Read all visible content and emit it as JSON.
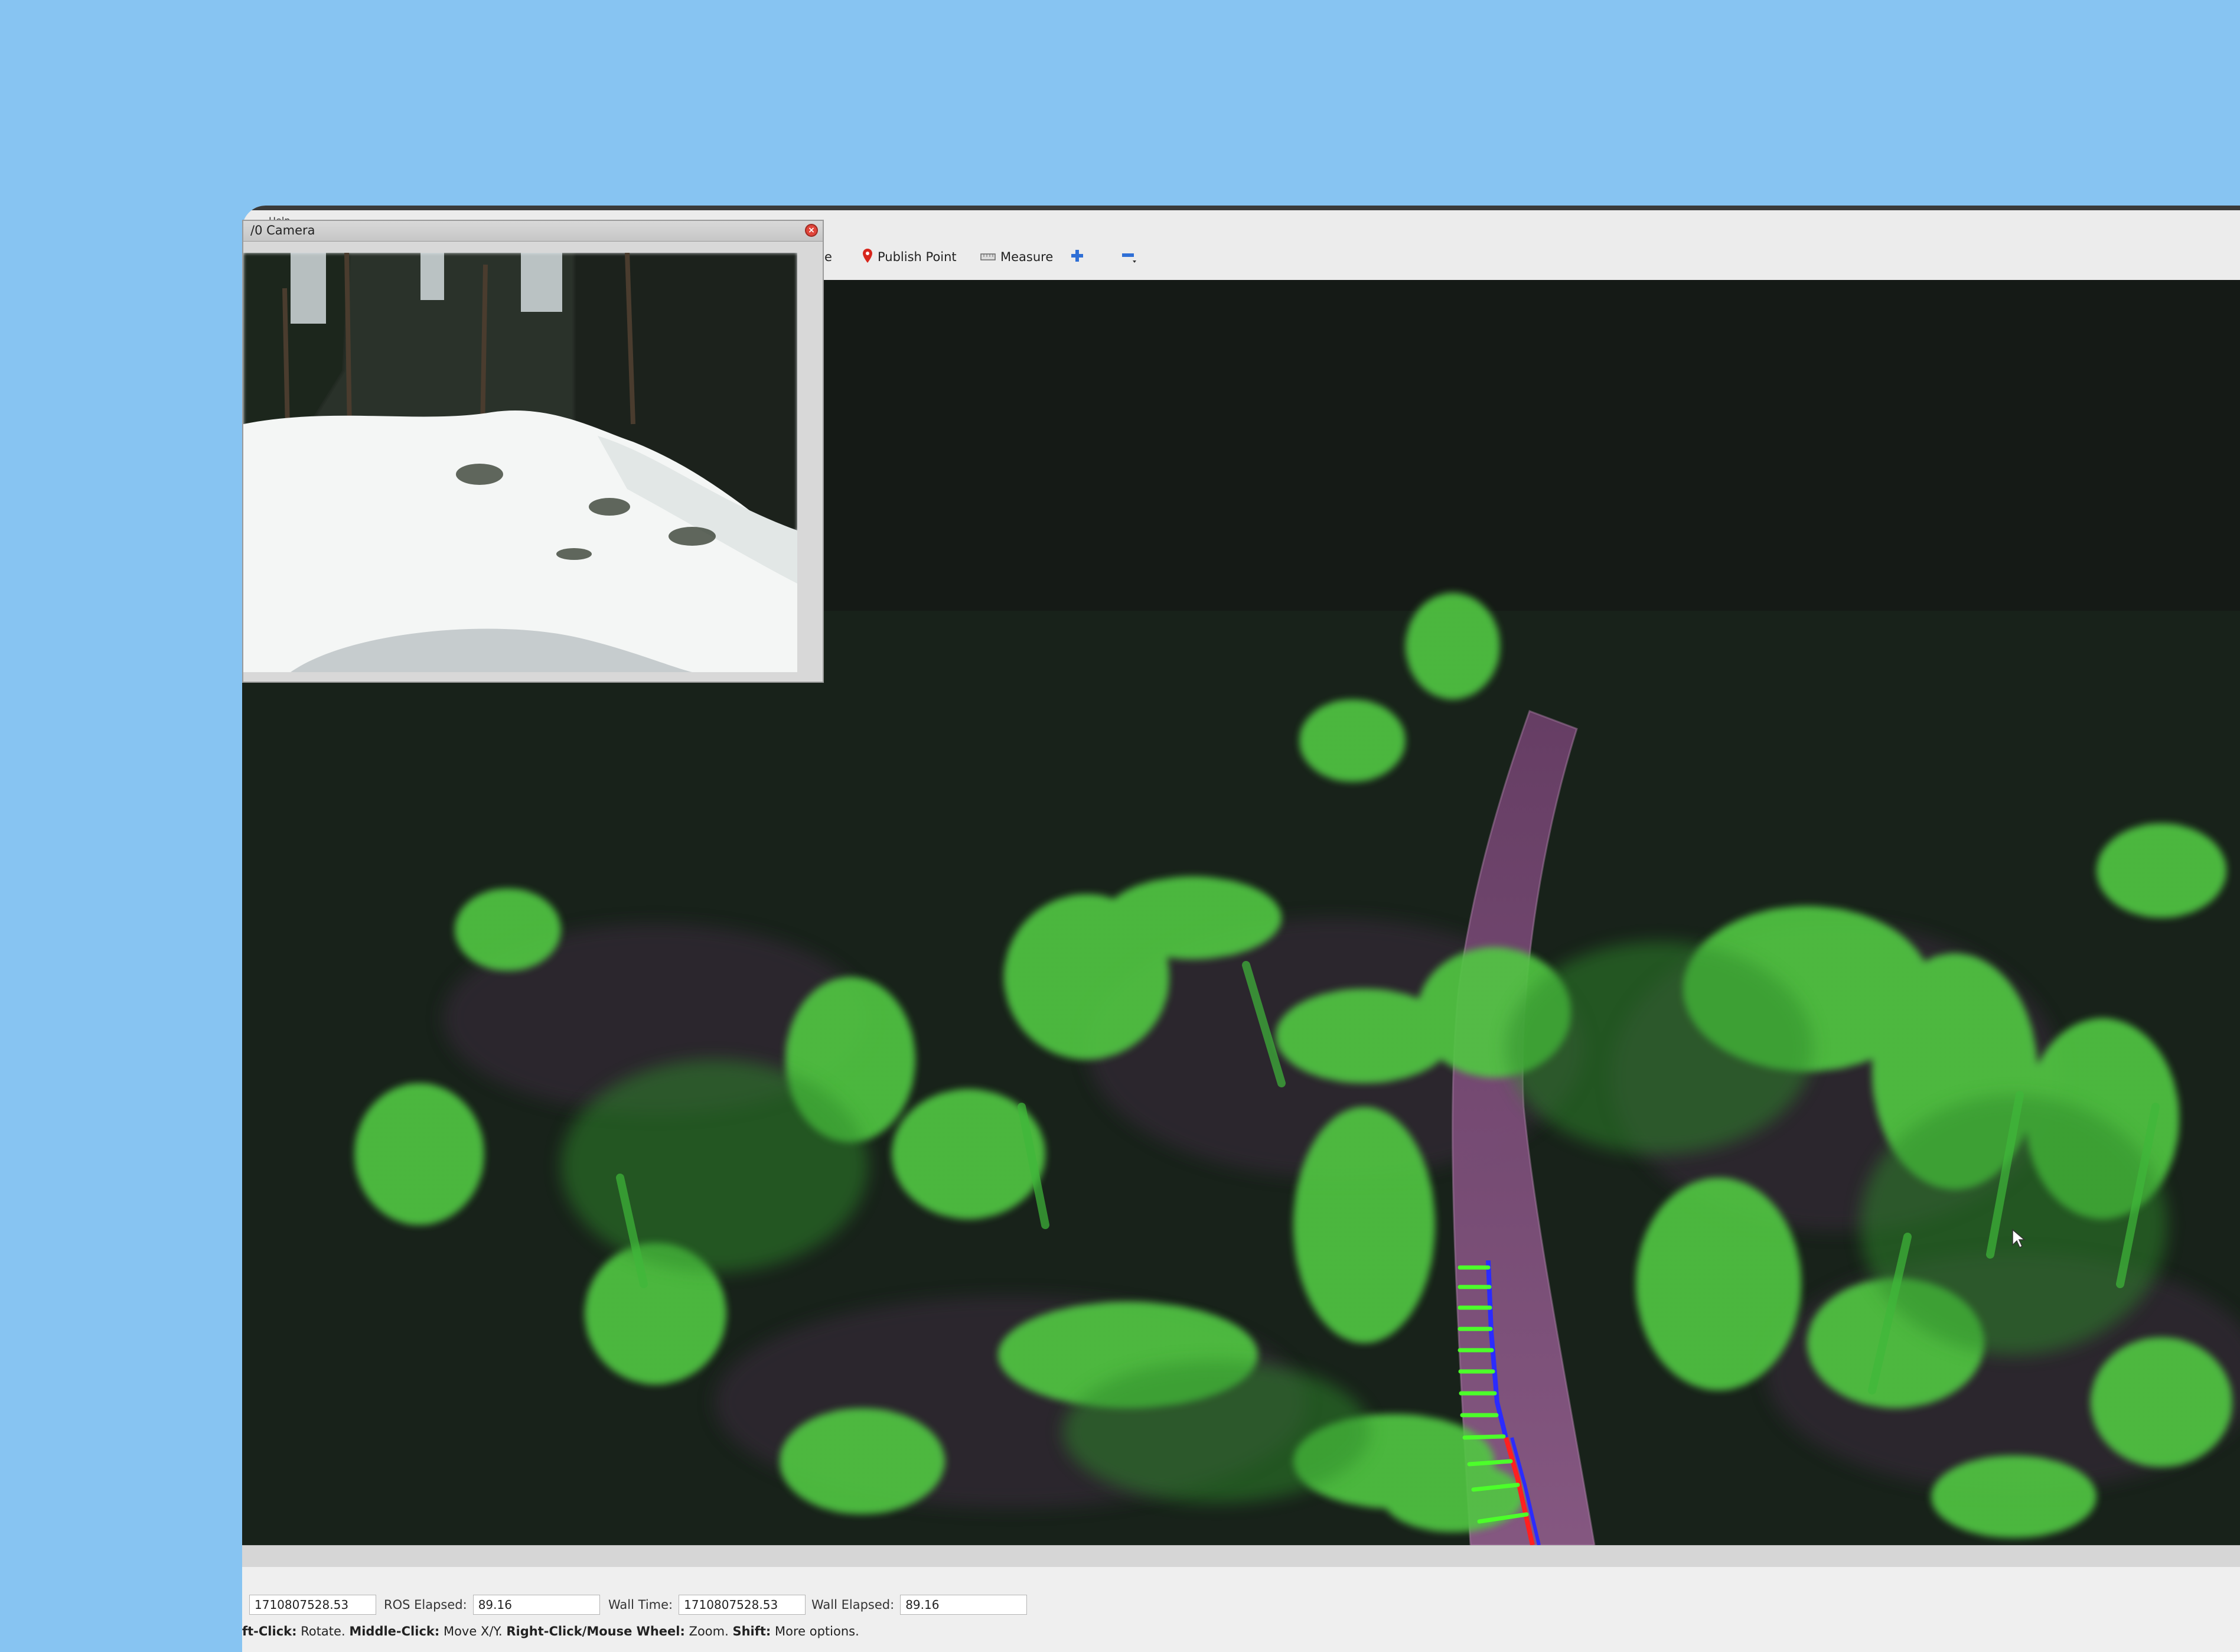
{
  "window": {
    "menubar_label": "Help"
  },
  "toolbar": {
    "partial_tool": "se",
    "publish_point": "Publish Point",
    "measure": "Measure"
  },
  "camera_panel": {
    "title": "/0 Camera"
  },
  "timebar": {
    "ros_time_value": "1710807528.53",
    "ros_elapsed_label": "ROS Elapsed:",
    "ros_elapsed_value": "89.16",
    "wall_time_label": "Wall Time:",
    "wall_time_value": "1710807528.53",
    "wall_elapsed_label": "Wall Elapsed:",
    "wall_elapsed_value": "89.16"
  },
  "hints": {
    "left_click_key": "ft-Click:",
    "left_click_desc": "Rotate.",
    "middle_click_key": "Middle-Click:",
    "middle_click_desc": "Move X/Y.",
    "right_click_key": "Right-Click/Mouse Wheel:",
    "right_click_desc": "Zoom.",
    "shift_key": "Shift:",
    "shift_desc": "More options."
  },
  "colors": {
    "background": "#87c4f2",
    "viewport_bg": "#151a16",
    "point_cloud_green": "#3fbf3a",
    "trail_purple": "#7a4a78",
    "path_blue": "#2b2bff",
    "path_red": "#ff2020",
    "pose_green": "#4cff2a"
  },
  "icons": [
    "publish-point-icon",
    "measure-icon",
    "plus-icon",
    "minus-icon",
    "close-icon",
    "cursor-icon"
  ]
}
